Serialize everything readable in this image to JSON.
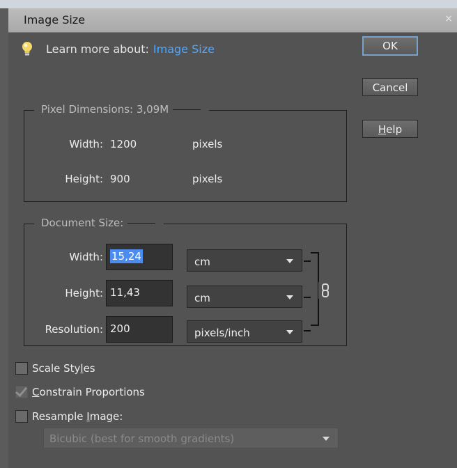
{
  "window": {
    "title": "Image Size",
    "close_glyph": "×"
  },
  "learn": {
    "prefix": "Learn more about:",
    "link": "Image Size",
    "icon": "lightbulb-icon"
  },
  "buttons": {
    "ok": "OK",
    "cancel": "Cancel",
    "help": "Help"
  },
  "pixel_dimensions": {
    "title": "Pixel Dimensions:  3,09M",
    "width_label": "Width:",
    "width_value": "1200",
    "width_unit": "pixels",
    "height_label": "Height:",
    "height_value": "900",
    "height_unit": "pixels"
  },
  "document_size": {
    "title": "Document Size:",
    "width_label": "Width:",
    "width_value": "15,24",
    "width_unit": "cm",
    "height_label": "Height:",
    "height_value": "11,43",
    "height_unit": "cm",
    "resolution_label": "Resolution:",
    "resolution_value": "200",
    "resolution_unit": "pixels/inch"
  },
  "options": {
    "scale_styles": {
      "label": "Scale Styles",
      "checked": false
    },
    "constrain": {
      "label": "Constrain Proportions",
      "checked": true,
      "disabled": true
    },
    "resample": {
      "label": "Resample Image:",
      "checked": false
    }
  },
  "resample_method": "Bicubic (best for smooth gradients)",
  "colors": {
    "link": "#4ea8ff",
    "panel": "#535353",
    "selection": "#4a8cf0"
  }
}
